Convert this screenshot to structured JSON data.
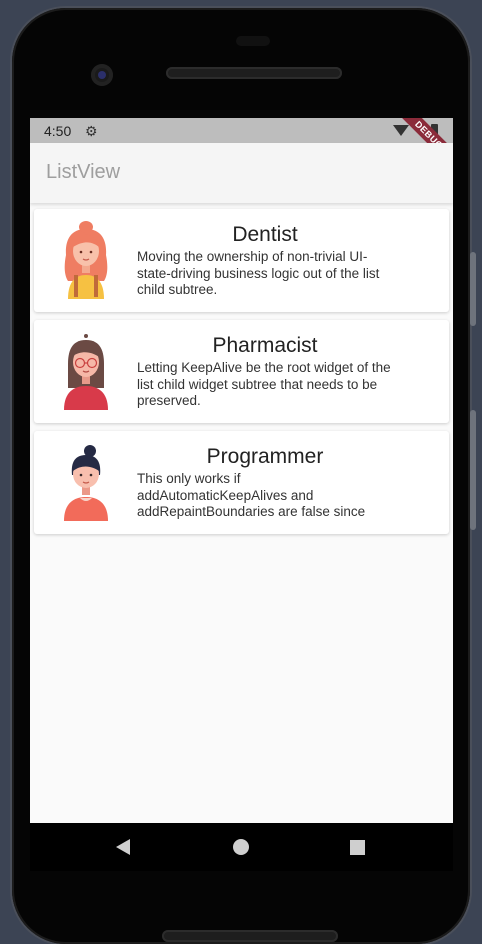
{
  "status_bar": {
    "time": "4:50"
  },
  "debug_banner": "DEBUG",
  "app_bar": {
    "title": "ListView"
  },
  "items": [
    {
      "title": "Dentist",
      "description": "Moving the ownership of non-trivial UI-state-driving business logic out of the list child subtree.",
      "avatar": "woman-red-hair-avatar",
      "colors": {
        "hair": "#ef7d62",
        "shirt": "#f6c142"
      }
    },
    {
      "title": "Pharmacist",
      "description": "Letting KeepAlive be the root widget of the list child widget subtree that needs to be preserved.",
      "avatar": "woman-glasses-avatar",
      "colors": {
        "hair": "#6b4a44",
        "shirt": "#d83a4a"
      }
    },
    {
      "title": "Programmer",
      "description": "This only works if addAutomaticKeepAlives and addRepaintBoundaries are false since",
      "avatar": "woman-bun-avatar",
      "colors": {
        "hair": "#252a44",
        "shirt": "#f26b5a"
      }
    }
  ],
  "nav_bar": {
    "back": "back-icon",
    "home": "home-icon",
    "recents": "recents-icon"
  }
}
